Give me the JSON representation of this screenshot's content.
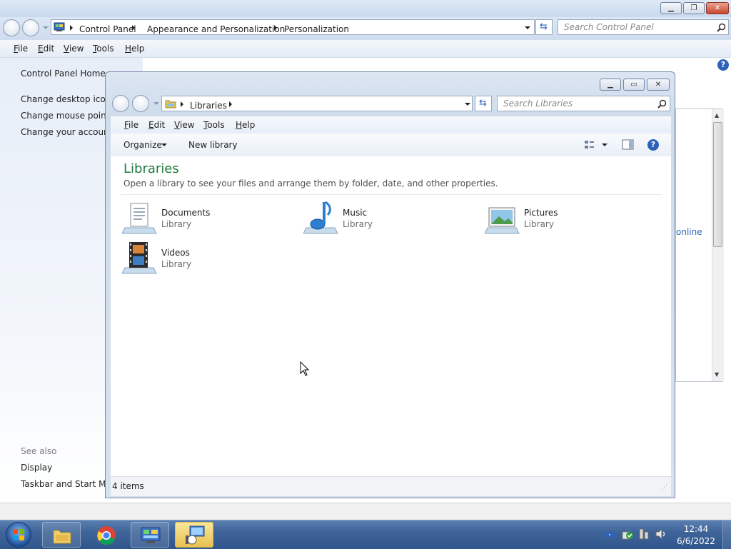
{
  "bg_window": {
    "breadcrumb": [
      "Control Panel",
      "Appearance and Personalization",
      "Personalization"
    ],
    "search_placeholder": "Search Control Panel",
    "menu": [
      "File",
      "Edit",
      "View",
      "Tools",
      "Help"
    ],
    "left_links": {
      "home": "Control Panel Home",
      "desktop_icons": "Change desktop icons",
      "mouse_pointers": "Change mouse pointe",
      "account": "Change your account"
    },
    "see_also": {
      "heading": "See also",
      "display": "Display",
      "taskbar": "Taskbar and Start Men"
    },
    "online_fragment": "online"
  },
  "lib_window": {
    "breadcrumb": [
      "Libraries"
    ],
    "search_placeholder": "Search Libraries",
    "menu": [
      "File",
      "Edit",
      "View",
      "Tools",
      "Help"
    ],
    "toolbar": {
      "organize": "Organize",
      "new_library": "New library"
    },
    "heading": "Libraries",
    "subheading": "Open a library to see your files and arrange them by folder, date, and other properties.",
    "items": [
      {
        "name": "Documents",
        "type": "Library"
      },
      {
        "name": "Music",
        "type": "Library"
      },
      {
        "name": "Pictures",
        "type": "Library"
      },
      {
        "name": "Videos",
        "type": "Library"
      }
    ],
    "status": "4 items"
  },
  "taskbar": {
    "time": "12:44",
    "date": "6/6/2022"
  },
  "colors": {
    "heading_green": "#1e7a3a",
    "taskbar_blue": "#3f6499",
    "active_task": "#e8c050"
  }
}
